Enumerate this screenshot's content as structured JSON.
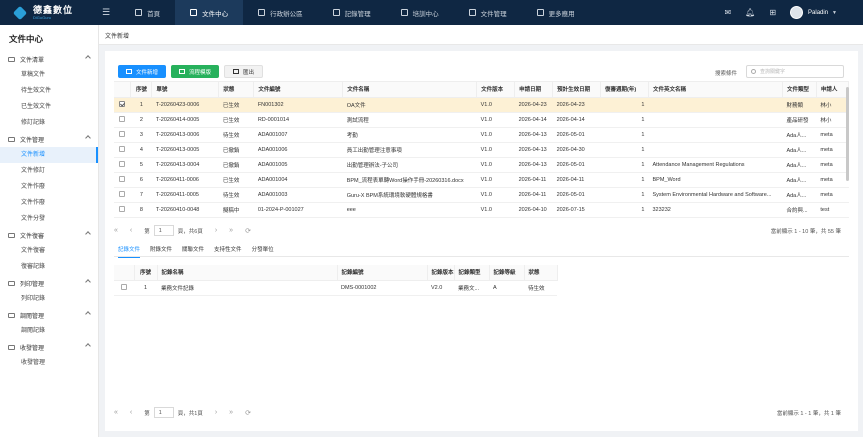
{
  "brand": {
    "cn": "德鑫數位",
    "en": "DiGoGuru"
  },
  "nav": [
    "首頁",
    "文件中心",
    "行政辦公區",
    "記錄管理",
    "培訓中心",
    "文件管理",
    "更多應用"
  ],
  "nav_active": 1,
  "user": "Paladin",
  "sidebar": {
    "title": "文件中心",
    "groups": [
      {
        "label": "文件清單",
        "items": [
          "草稿文件",
          "待生效文件",
          "已生效文件",
          "修訂記錄"
        ]
      },
      {
        "label": "文件管理",
        "items": [
          "文件新增",
          "文件修訂",
          "文件作廢",
          "文件作廢",
          "文件分發"
        ]
      },
      {
        "label": "文件復審",
        "items": [
          "文件復審",
          "復審記錄"
        ]
      },
      {
        "label": "列印管理",
        "items": [
          "列印記錄"
        ]
      },
      {
        "label": "調閱管理",
        "items": [
          "調閱記錄"
        ]
      },
      {
        "label": "收發管理",
        "items": [
          "收發管理"
        ]
      }
    ]
  },
  "breadcrumb": "文件新增",
  "toolbar": {
    "add": "文件新增",
    "template": "流程模版",
    "export": "匯出"
  },
  "search": {
    "label": "搜索條件",
    "placeholder": "查詢關鍵字"
  },
  "main_table": {
    "headers": [
      "",
      "序號",
      "單號",
      "狀態",
      "文件編號",
      "文件名稱",
      "文件版本",
      "申請日期",
      "預計生效日期",
      "復審週期(年)",
      "文件英文名稱",
      "文件類型",
      "申請人"
    ],
    "rows": [
      [
        "",
        "1",
        "T-20260423-0006",
        "已生效",
        "FN001302",
        "OA文件",
        "V1.0",
        "2026-04-23",
        "2026-04-23",
        "1",
        "",
        "財務類",
        "林小"
      ],
      [
        "",
        "2",
        "T-20260414-0005",
        "已生效",
        "RD-0001014",
        "測試流程",
        "V1.0",
        "2026-04-14",
        "2026-04-14",
        "1",
        "",
        "產品研發",
        "林小"
      ],
      [
        "",
        "3",
        "T-20260413-0006",
        "待生效",
        "ADA001007",
        "考勤",
        "V1.0",
        "2026-04-13",
        "2026-05-01",
        "1",
        "",
        "Ada人...",
        "meta"
      ],
      [
        "",
        "4",
        "T-20260413-0005",
        "已撤銷",
        "ADA001006",
        "員工出勤管理注意事項",
        "V1.0",
        "2026-04-13",
        "2026-04-30",
        "1",
        "",
        "Ada人...",
        "meta"
      ],
      [
        "",
        "5",
        "T-20260413-0004",
        "已撤銷",
        "ADA001005",
        "出勤管理辦法-子公司",
        "V1.0",
        "2026-04-13",
        "2026-05-01",
        "1",
        "Attendance Management Regulations",
        "Ada人...",
        "meta"
      ],
      [
        "",
        "6",
        "T-20260411-0006",
        "已生效",
        "ADA001004",
        "BPM_流程表單轉Word操作手冊-20260316.docx",
        "V1.0",
        "2026-04-11",
        "2026-04-11",
        "1",
        "BPM_Word",
        "Ada人...",
        "meta"
      ],
      [
        "",
        "7",
        "T-20260411-0005",
        "待生效",
        "ADA001003",
        "Guru-X BPM系統環境軟硬體規格書",
        "V1.0",
        "2026-04-11",
        "2026-05-01",
        "1",
        "System Environmental Hardware and Software...",
        "Ada人...",
        "meta"
      ],
      [
        "",
        "8",
        "T-20260410-0048",
        "擬稿中",
        "01-2024-P-001027",
        "eee",
        "V1.0",
        "2026-04-10",
        "2026-07-15",
        "1",
        "323232",
        "合約與...",
        "test"
      ]
    ],
    "selected_row": 0
  },
  "pager1": {
    "page_label_pre": "第",
    "page": "1",
    "page_label_post": "頁，共6頁",
    "info": "當前顯示 1 - 10 筆，共 55 筆"
  },
  "tabs": [
    "記錄文件",
    "附錄文件",
    "關聯文件",
    "支持性文件",
    "分發單位"
  ],
  "tab_active": 0,
  "record_table": {
    "headers": [
      "",
      "序號",
      "記錄名稱",
      "記錄編號",
      "記錄版本",
      "記錄類型",
      "記錄等級",
      "狀態"
    ],
    "rows": [
      [
        "",
        "1",
        "業務文件記錄",
        "DMS-0001002",
        "V2.0",
        "業務文...",
        "A",
        "待生效"
      ]
    ]
  },
  "pager2": {
    "page_label_pre": "第",
    "page": "1",
    "page_label_post": "頁，共1頁",
    "info": "當前顯示 1 - 1 筆，共 1 筆"
  }
}
